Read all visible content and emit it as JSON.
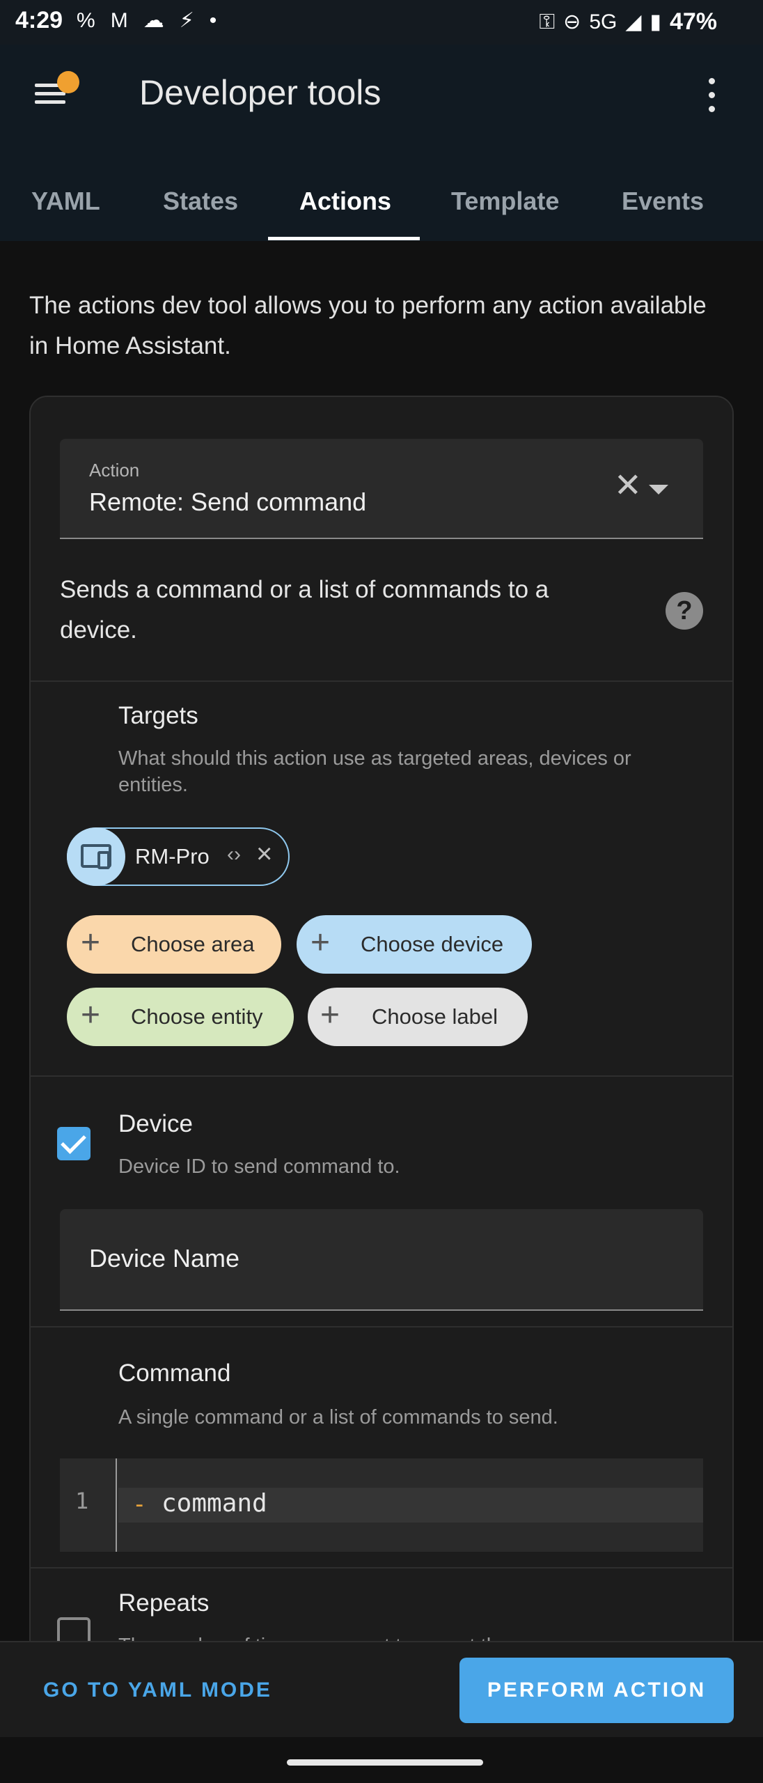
{
  "status_bar": {
    "time": "4:29",
    "left_icons": [
      "%",
      "M",
      "☁",
      "⚡",
      "•"
    ],
    "network": "5G",
    "battery": "47%"
  },
  "app_bar": {
    "title": "Developer tools"
  },
  "tabs": [
    {
      "label": "YAML",
      "active": false
    },
    {
      "label": "States",
      "active": false
    },
    {
      "label": "Actions",
      "active": true
    },
    {
      "label": "Template",
      "active": false
    },
    {
      "label": "Events",
      "active": false
    }
  ],
  "intro": "The actions dev tool allows you to perform any action available in Home Assistant.",
  "action_field": {
    "label": "Action",
    "value": "Remote: Send command"
  },
  "action_description": "Sends a command or a list of commands to a device.",
  "targets": {
    "title": "Targets",
    "description": "What should this action use as targeted areas, devices or entities.",
    "selected": [
      {
        "label": "RM-Pro",
        "icon": "remote-device-icon"
      }
    ],
    "choose_area": "Choose area",
    "choose_device": "Choose device",
    "choose_entity": "Choose entity",
    "choose_label": "Choose label"
  },
  "device": {
    "title": "Device",
    "description": "Device ID to send command to.",
    "checked": true,
    "field_placeholder": "Device Name"
  },
  "command": {
    "title": "Command",
    "description": "A single command or a list of commands to send.",
    "line_number": "1",
    "dash": "-",
    "code": "command"
  },
  "repeats": {
    "title": "Repeats",
    "description": "The number of times you want to repeat the",
    "checked": false
  },
  "actions": {
    "yaml_mode": "GO TO YAML MODE",
    "perform": "PERFORM ACTION"
  },
  "colors": {
    "accent": "#4aa6e8",
    "area": "#fad7ab",
    "device": "#b7dcf5",
    "entity": "#d6e8be",
    "label": "#e3e3e3"
  }
}
